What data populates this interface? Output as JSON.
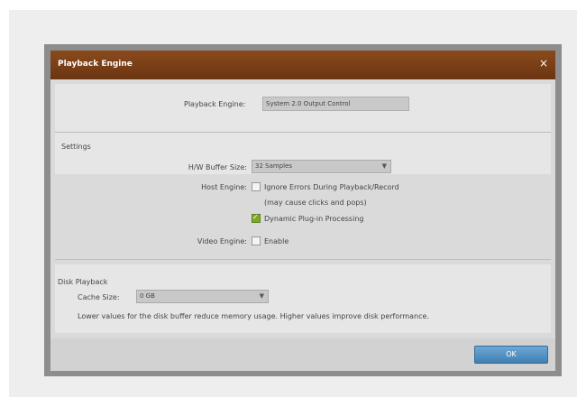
{
  "dialog": {
    "title": "Playback Engine",
    "close_glyph": "×"
  },
  "engine": {
    "label": "Playback Engine:",
    "value": "System 2.0 Output Control"
  },
  "settings": {
    "title": "Settings",
    "hw_buffer": {
      "label": "H/W Buffer Size:",
      "value": "32 Samples"
    },
    "host_engine": {
      "label": "Host Engine:",
      "ignore_errors": {
        "label": "Ignore Errors During Playback/Record",
        "checked": false
      },
      "note": "(may cause clicks and pops)",
      "dynamic_plugin": {
        "label": "Dynamic Plug-in Processing",
        "checked": true
      }
    },
    "video_engine": {
      "label": "Video Engine:",
      "enable": {
        "label": "Enable",
        "checked": false
      }
    }
  },
  "disk_playback": {
    "title": "Disk Playback",
    "cache_size": {
      "label": "Cache Size:",
      "value": "0 GB"
    },
    "hint": "Lower values for the disk buffer reduce memory usage. Higher values improve disk performance."
  },
  "footer": {
    "ok_label": "OK"
  },
  "colors": {
    "titlebar": "#7a3e16",
    "ok_button": "#4f8fc4",
    "checked_box": "#7fa82b"
  }
}
